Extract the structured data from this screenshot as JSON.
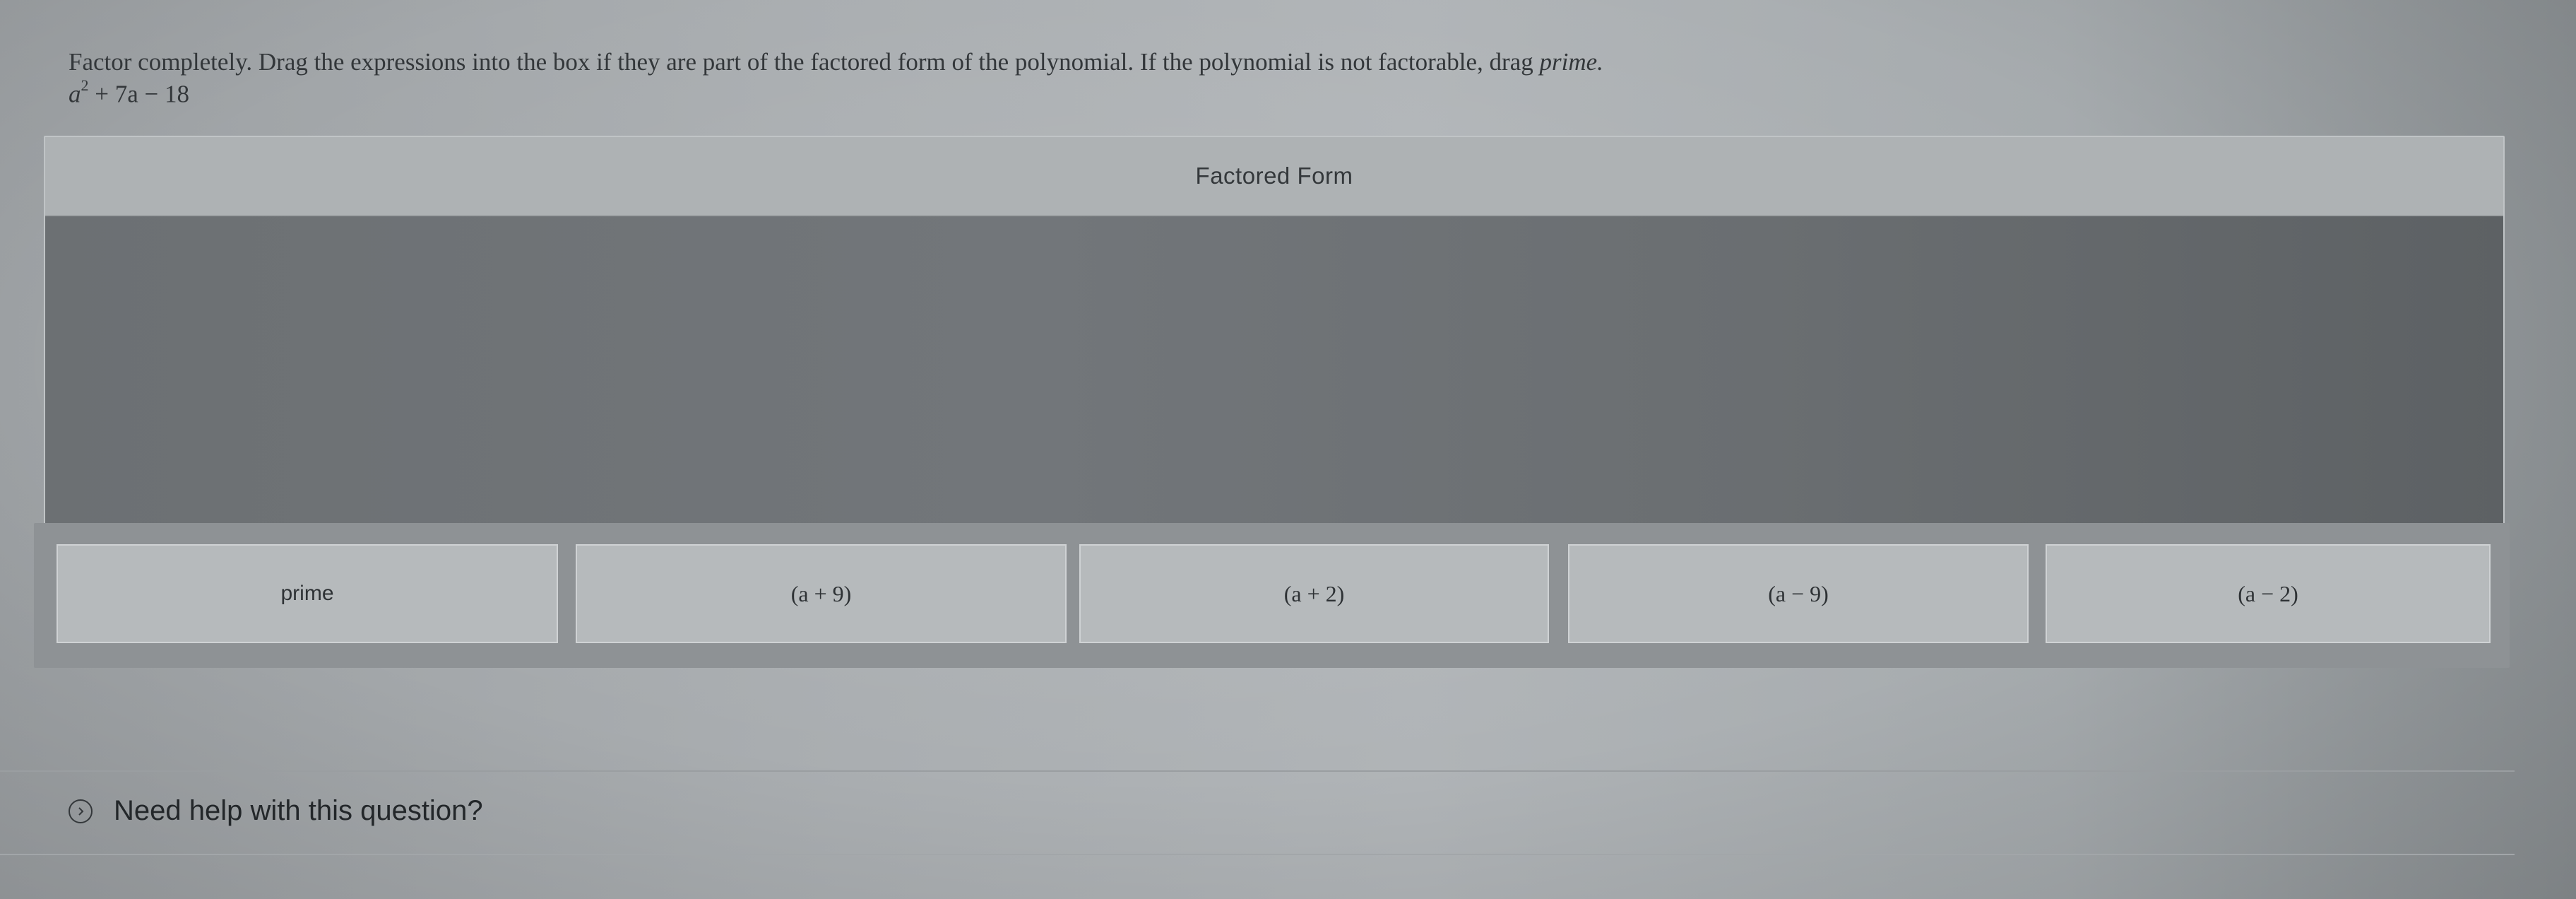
{
  "question": {
    "instruction_main": "Factor completely. Drag the expressions into the box if they are part of the factored form of the polynomial. If the polynomial is not factorable, drag",
    "instruction_prime": "prime.",
    "polynomial_var": "a",
    "polynomial_exp": "2",
    "polynomial_rest": "+ 7a − 18"
  },
  "dropzone": {
    "title": "Factored Form"
  },
  "tiles": [
    {
      "label": "prime"
    },
    {
      "label": "(a + 9)"
    },
    {
      "label": "(a + 2)"
    },
    {
      "label": "(a − 9)"
    },
    {
      "label": "(a − 2)"
    }
  ],
  "help": {
    "label": "Need help with this question?",
    "icon": "chevron-right-circle-icon"
  }
}
